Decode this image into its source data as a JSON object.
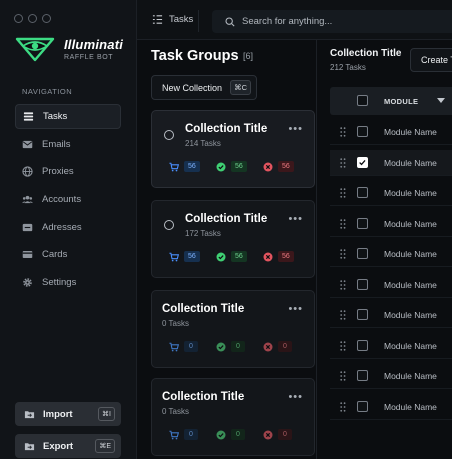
{
  "brand": {
    "title": "Illuminati",
    "subtitle": "RAFFLE BOT"
  },
  "nav": {
    "heading": "NAVIGATION",
    "items": [
      {
        "label": "Tasks",
        "icon": "tasks-icon",
        "active": true
      },
      {
        "label": "Emails",
        "icon": "mail-icon"
      },
      {
        "label": "Proxies",
        "icon": "globe-icon"
      },
      {
        "label": "Accounts",
        "icon": "users-icon"
      },
      {
        "label": "Adresses",
        "icon": "address-card-icon"
      },
      {
        "label": "Cards",
        "icon": "credit-card-icon"
      },
      {
        "label": "Settings",
        "icon": "gear-icon"
      }
    ]
  },
  "sidebar_actions": {
    "import": {
      "label": "Import",
      "shortcut": "⌘I"
    },
    "export": {
      "label": "Export",
      "shortcut": "⌘E"
    }
  },
  "topbar": {
    "crumb": "Tasks",
    "search_placeholder": "Search for anything..."
  },
  "groups": {
    "title": "Task Groups",
    "count": "[6]",
    "new_collection": {
      "label": "New Collection",
      "shortcut": "⌘C"
    },
    "cards": [
      {
        "title": "Collection Title",
        "subtitle": "214 Tasks",
        "selected": true,
        "radio": true,
        "stats": [
          "56",
          "56",
          "56"
        ]
      },
      {
        "title": "Collection Title",
        "subtitle": "172 Tasks",
        "selected": false,
        "radio": true,
        "stats": [
          "56",
          "56",
          "56"
        ]
      },
      {
        "title": "Collection Title",
        "subtitle": "0 Tasks",
        "selected": false,
        "radio": false,
        "stats": [
          "0",
          "0",
          "0"
        ]
      },
      {
        "title": "Collection Title",
        "subtitle": "0 Tasks",
        "selected": false,
        "radio": false,
        "stats": [
          "0",
          "0",
          "0"
        ]
      }
    ]
  },
  "panel": {
    "title": "Collection Title",
    "subtitle": "212 Tasks",
    "create_label": "Create Task",
    "table": {
      "column": "MODULE",
      "rows": [
        {
          "name": "Module Name",
          "checked": false
        },
        {
          "name": "Module Name",
          "checked": true
        },
        {
          "name": "Module Name",
          "checked": false
        },
        {
          "name": "Module Name",
          "checked": false
        },
        {
          "name": "Module Name",
          "checked": false
        },
        {
          "name": "Module Name",
          "checked": false
        },
        {
          "name": "Module Name",
          "checked": false
        },
        {
          "name": "Module Name",
          "checked": false
        },
        {
          "name": "Module Name",
          "checked": false
        },
        {
          "name": "Module Name",
          "checked": false
        }
      ]
    }
  },
  "colors": {
    "accent_green": "#3ddc84",
    "blue": "#3b82f6",
    "green": "#22c55e",
    "red": "#ef4444"
  }
}
